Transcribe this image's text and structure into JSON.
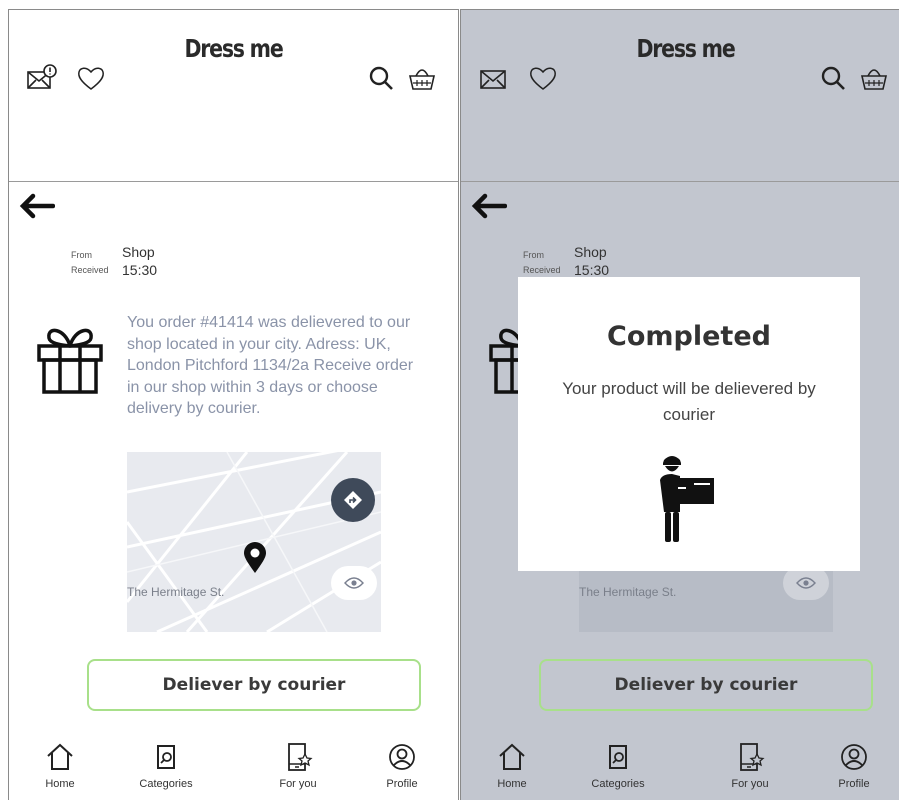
{
  "app": {
    "title": "Dress me"
  },
  "message": {
    "from_label": "From",
    "received_label": "Received",
    "from_value": "Shop",
    "received_value": "15:30",
    "body": "You order #41414 was delievered to our shop located in your city. Adress: UK, London Pitchford 1134/2a Receive order in our shop within 3 days or choose delivery by courier."
  },
  "map": {
    "street": "The Hermitage St."
  },
  "actions": {
    "courier_button": "Deliever by courier"
  },
  "nav": {
    "items": [
      {
        "label": "Home",
        "icon": "home-icon"
      },
      {
        "label": "Categories",
        "icon": "categories-icon"
      },
      {
        "label": "For you",
        "icon": "for-you-icon"
      },
      {
        "label": "Profile",
        "icon": "profile-icon"
      }
    ]
  },
  "modal": {
    "title": "Completed",
    "text": "Your product will be delievered by courier",
    "icon": "courier-icon"
  },
  "colors": {
    "accent_green": "#a8e08a",
    "message_text": "#8a93a8",
    "overlay": "#c2c6cf",
    "map_button": "#3f4a5a"
  }
}
